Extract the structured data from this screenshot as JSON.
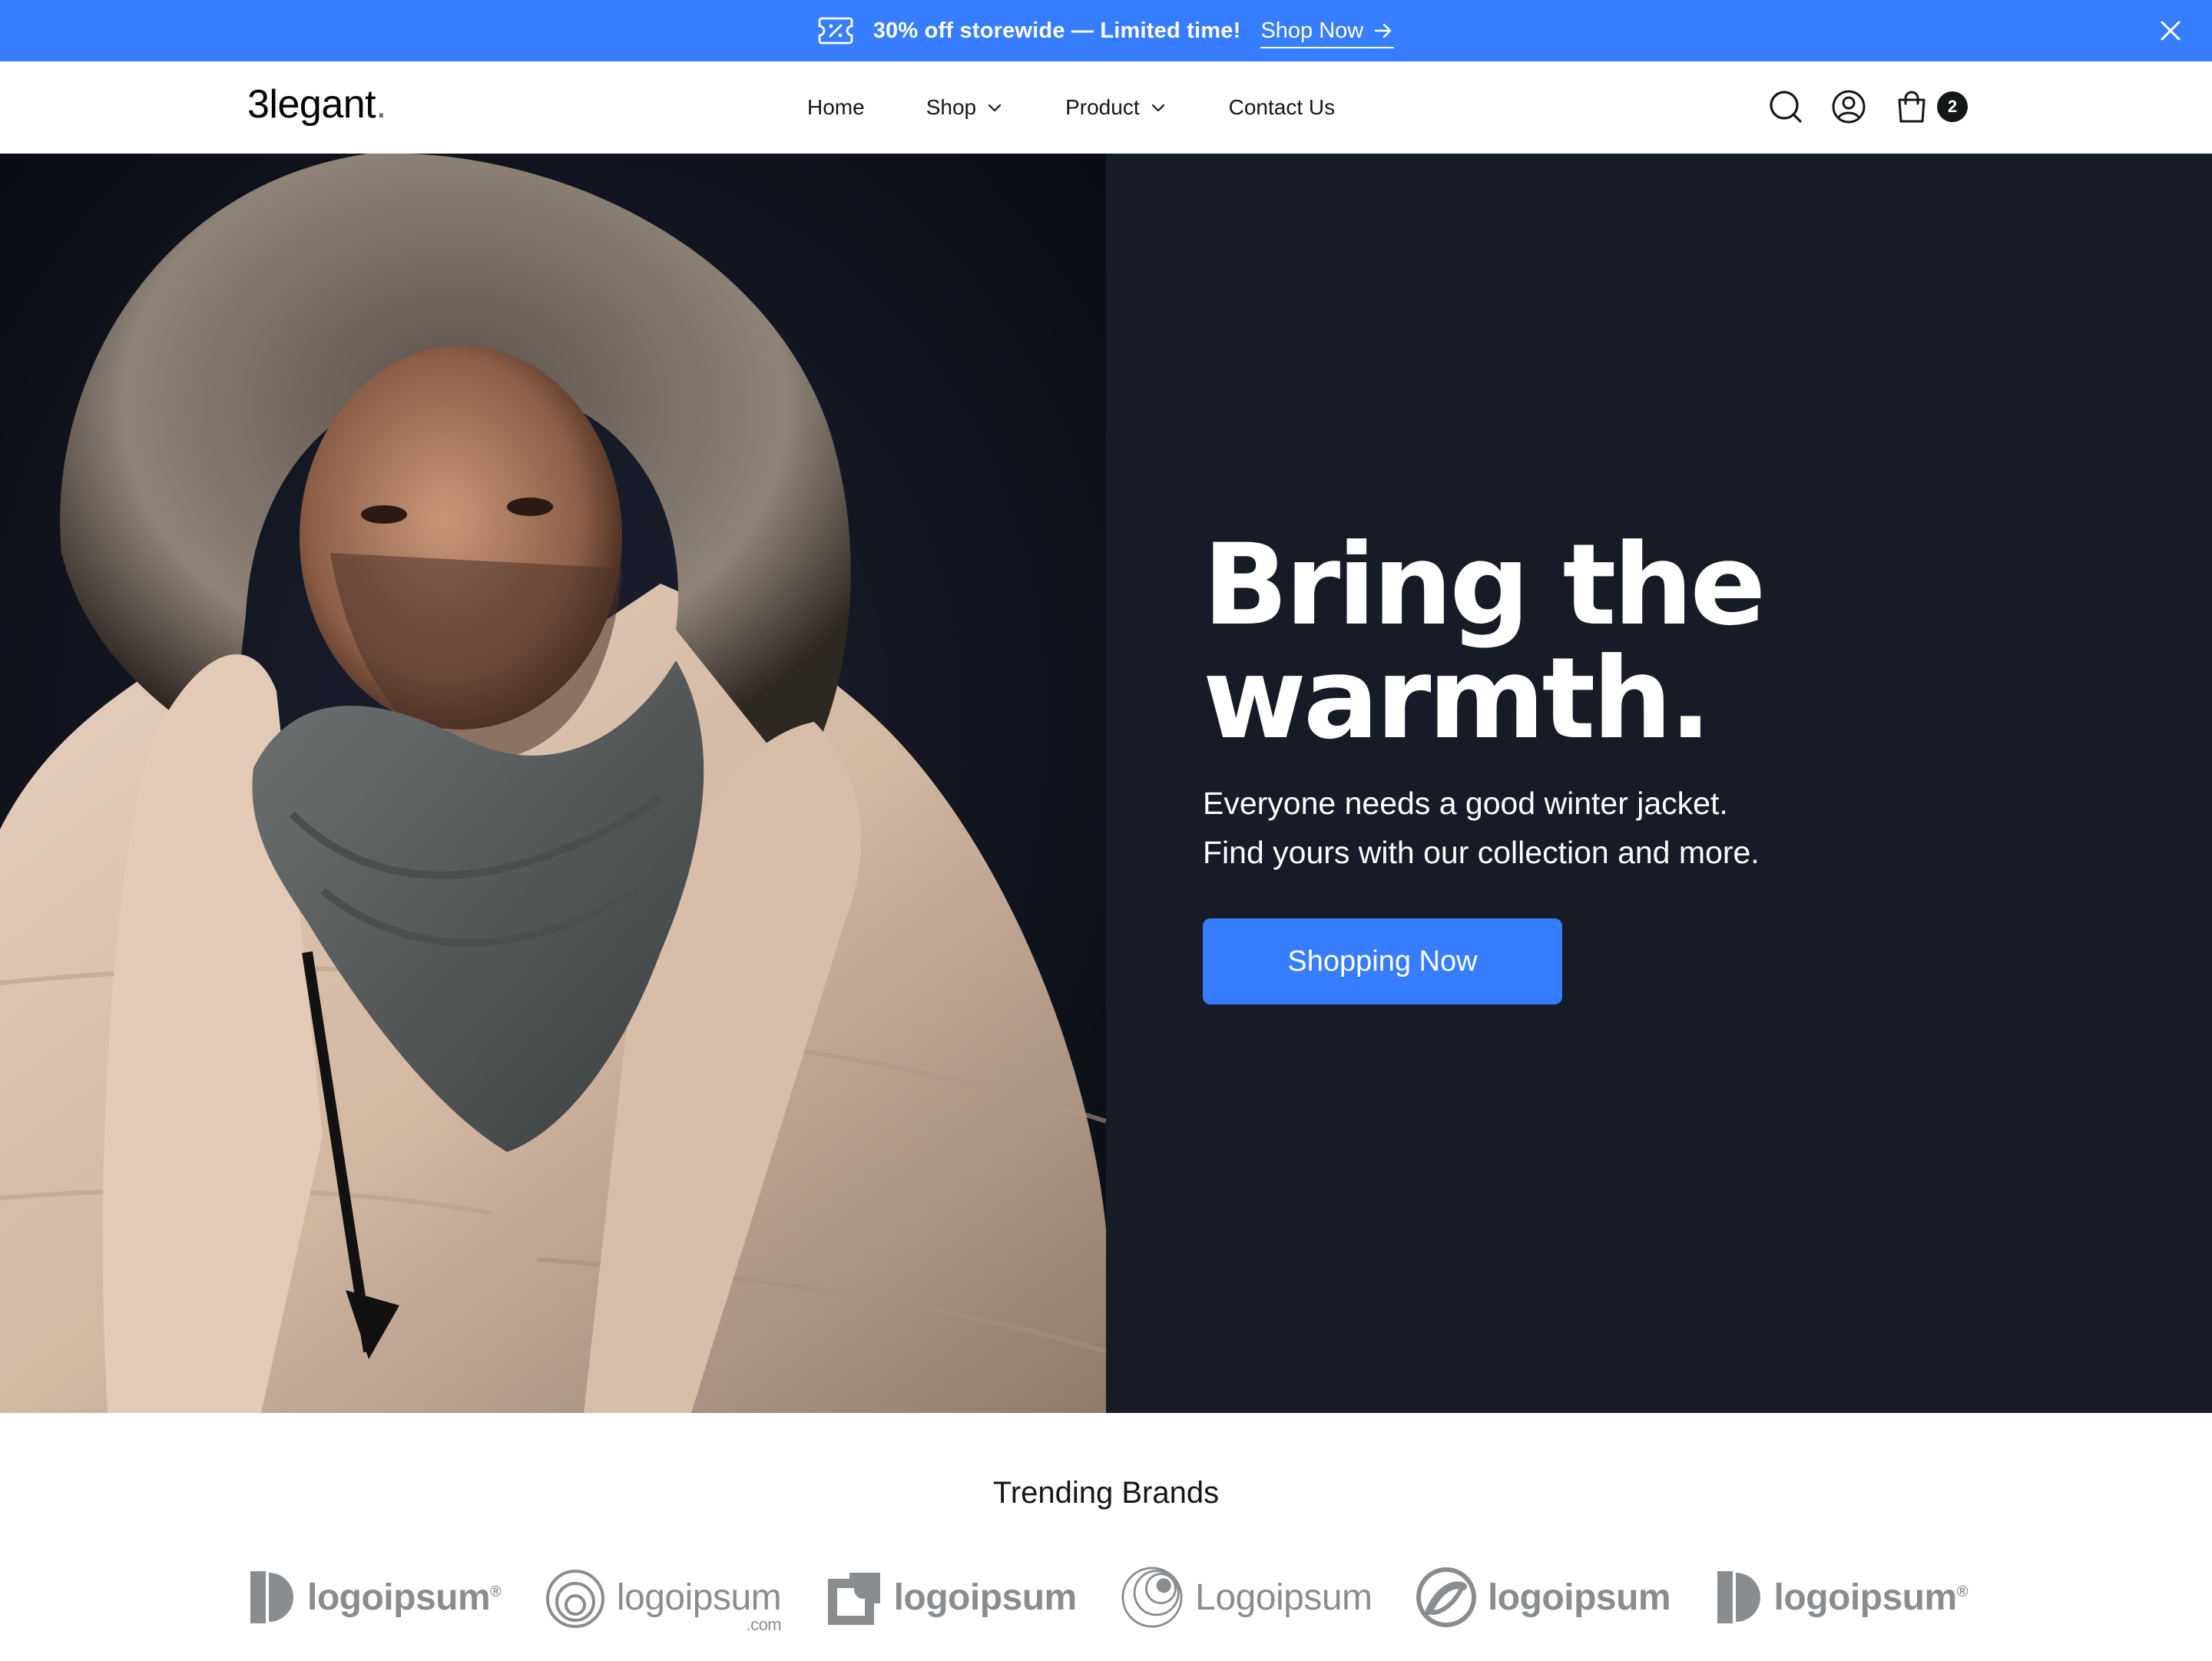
{
  "announcement": {
    "message": "30% off storewide — Limited time!",
    "cta_label": "Shop Now"
  },
  "header": {
    "logo_main": "3legant",
    "logo_dot": ".",
    "nav": [
      {
        "label": "Home"
      },
      {
        "label": "Shop"
      },
      {
        "label": "Product"
      },
      {
        "label": "Contact Us"
      }
    ],
    "cart_count": "2"
  },
  "hero": {
    "title_line1": "Bring the",
    "title_line2": "warmth.",
    "subtitle_line1": "Everyone needs a good winter jacket.",
    "subtitle_line2": "Find yours with our collection and more.",
    "button_label": "Shopping Now"
  },
  "brands": {
    "title": "Trending Brands",
    "items": [
      {
        "name": "logoipsum",
        "mark": "®"
      },
      {
        "name": "logoipsum",
        "suffix": ".com"
      },
      {
        "name": "logoipsum"
      },
      {
        "name": "Logoipsum"
      },
      {
        "name": "logoipsum"
      },
      {
        "name": "logoipsum",
        "mark": "®"
      }
    ]
  },
  "colors": {
    "accent": "#377DFF",
    "hero_bg": "#171B28",
    "text_dark": "#141718",
    "brand_gray": "#8A8D90"
  }
}
